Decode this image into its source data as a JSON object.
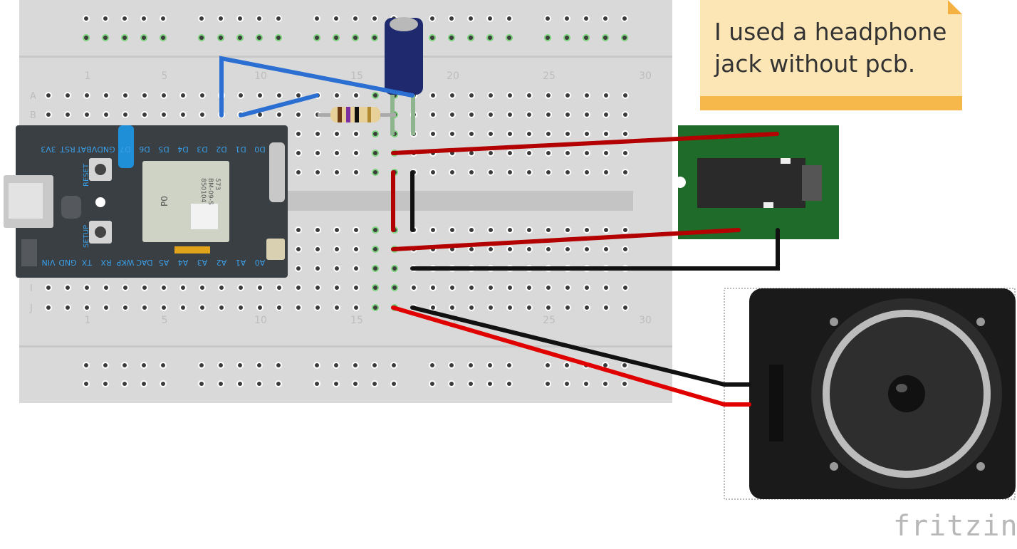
{
  "note": {
    "text": "I used a headphone jack without pcb."
  },
  "brand": {
    "name": "fritzing"
  },
  "breadboard": {
    "column_numbers": [
      "1",
      "5",
      "10",
      "15",
      "20",
      "25",
      "30"
    ],
    "row_letters_top": [
      "A",
      "B"
    ],
    "row_letters_bottom": [
      "I",
      "J"
    ]
  },
  "photon": {
    "top_pins": [
      "3V3",
      "RST",
      "VBAT",
      "GND",
      "D7",
      "D6",
      "D5",
      "D4",
      "D3",
      "D2",
      "D1",
      "D0"
    ],
    "bottom_pins": [
      "VIN",
      "GND",
      "TX",
      "RX",
      "WKP",
      "DAC",
      "A5",
      "A4",
      "A3",
      "A2",
      "A1",
      "A0"
    ],
    "reset_label": "RESET",
    "setup_label": "SETUP",
    "chip_label": "P0",
    "chip_text_1": "850104",
    "chip_text_2": "BM-09-S",
    "chip_text_3": "573"
  },
  "colors": {
    "breadboard": "#d9d9d9",
    "wire_blue": "#2a6fd1",
    "wire_red": "#c00000",
    "wire_black": "#111111",
    "photon_body": "#3a3f44",
    "jack_pcb": "#1f6b2a",
    "speaker_body": "#1a1a1a"
  }
}
